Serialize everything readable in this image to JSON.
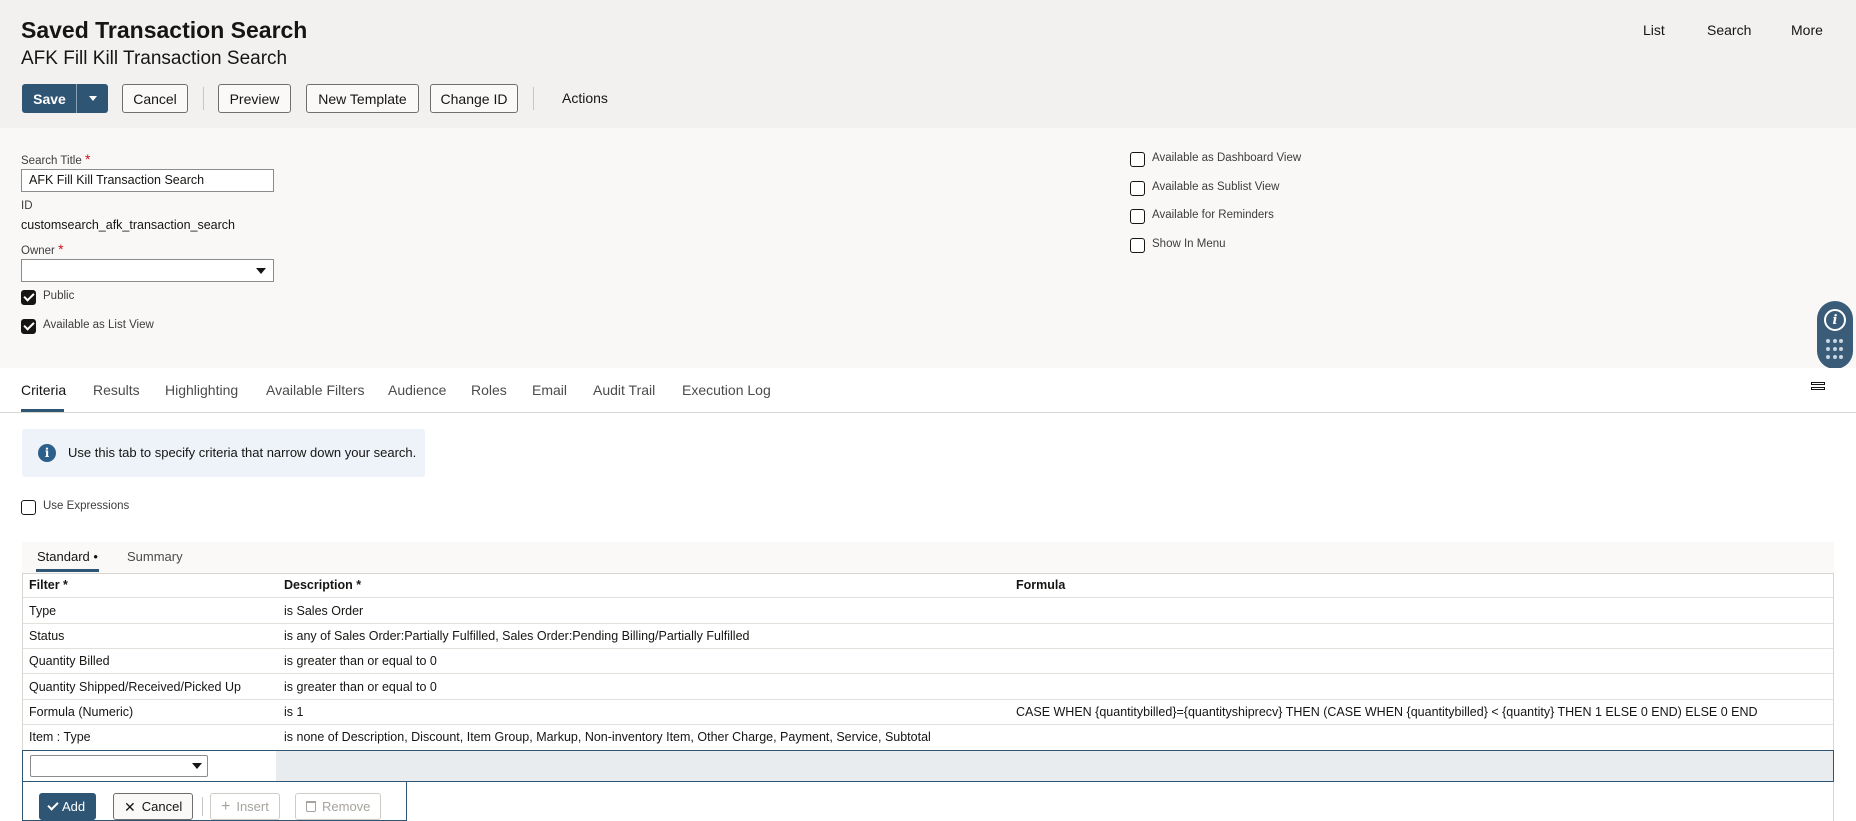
{
  "header": {
    "title": "Saved Transaction Search",
    "record_name": "AFK Fill Kill Transaction Search",
    "nav": [
      "List",
      "Search",
      "More"
    ]
  },
  "toolbar": {
    "save_label": "Save",
    "cancel_label": "Cancel",
    "preview_label": "Preview",
    "new_template_label": "New Template",
    "change_id_label": "Change ID",
    "actions_label": "Actions"
  },
  "form": {
    "search_title_label": "Search Title",
    "search_title_value": "AFK Fill Kill Transaction Search",
    "id_label": "ID",
    "id_value": "customsearch_afk_transaction_search",
    "owner_label": "Owner",
    "owner_value": "",
    "required_mark": "*",
    "checkboxes_left": [
      {
        "label": "Public",
        "checked": true
      },
      {
        "label": "Available as List View",
        "checked": true
      }
    ],
    "checkboxes_right": [
      {
        "label": "Available as Dashboard View",
        "checked": false
      },
      {
        "label": "Available as Sublist View",
        "checked": false
      },
      {
        "label": "Available for Reminders",
        "checked": false
      },
      {
        "label": "Show In Menu",
        "checked": false
      }
    ]
  },
  "tabs": [
    "Criteria",
    "Results",
    "Highlighting",
    "Available Filters",
    "Audience",
    "Roles",
    "Email",
    "Audit Trail",
    "Execution Log"
  ],
  "active_tab": "Criteria",
  "criteria": {
    "info_text": "Use this tab to specify criteria that narrow down your search.",
    "use_expressions_label": "Use Expressions",
    "use_expressions_checked": false,
    "subtabs": [
      "Standard •",
      "Summary"
    ],
    "columns": [
      "Filter *",
      "Description *",
      "Formula"
    ],
    "rows": [
      {
        "filter": "Type",
        "description": "is Sales Order",
        "formula": ""
      },
      {
        "filter": "Status",
        "description": "is any of Sales Order:Partially Fulfilled, Sales Order:Pending Billing/Partially Fulfilled",
        "formula": ""
      },
      {
        "filter": "Quantity Billed",
        "description": "is greater than or equal to 0",
        "formula": ""
      },
      {
        "filter": "Quantity Shipped/Received/Picked Up",
        "description": "is greater than or equal to 0",
        "formula": ""
      },
      {
        "filter": "Formula (Numeric)",
        "description": "is 1",
        "formula": "CASE WHEN {quantitybilled}={quantityshiprecv} THEN (CASE WHEN {quantitybilled} < {quantity} THEN 1 ELSE 0 END) ELSE 0 END"
      },
      {
        "filter": "Item : Type",
        "description": "is none of Description, Discount, Item Group, Markup, Non-inventory Item, Other Charge, Payment, Service, Subtotal",
        "formula": ""
      }
    ],
    "row_actions": {
      "add_label": "Add",
      "cancel_label": "Cancel",
      "insert_label": "Insert",
      "remove_label": "Remove"
    }
  },
  "widget": {
    "info_icon": "info-icon",
    "grid_icon": "dots-grid-icon"
  }
}
